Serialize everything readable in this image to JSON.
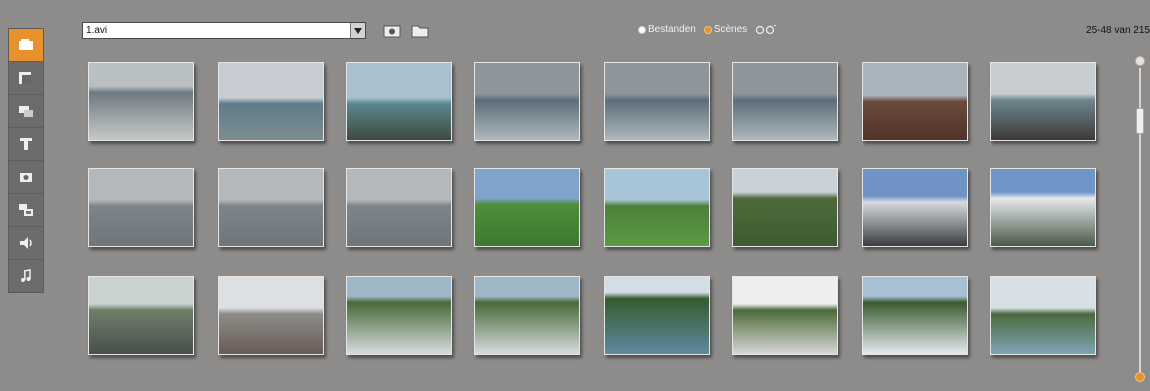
{
  "sidebar": {
    "items": [
      {
        "icon": "video-library-icon",
        "active": true
      },
      {
        "icon": "transitions-icon",
        "active": false
      },
      {
        "icon": "titles-icon",
        "active": false
      },
      {
        "icon": "text-icon",
        "active": false
      },
      {
        "icon": "photo-icon",
        "active": false
      },
      {
        "icon": "menu-icon",
        "active": false
      },
      {
        "icon": "sound-effects-icon",
        "active": false
      },
      {
        "icon": "music-icon",
        "active": false
      }
    ]
  },
  "toolbar": {
    "file_value": "1.avi",
    "radio_files": "Bestanden",
    "radio_scenes": "Scènes",
    "counter": "25-48 van 215"
  },
  "colors": {
    "accent": "#e8922e",
    "background": "#8e8c8a"
  },
  "scenes": [
    {
      "theme": "ferry-deck"
    },
    {
      "theme": "harbor-side"
    },
    {
      "theme": "harbor-cliff"
    },
    {
      "theme": "ferry-wake"
    },
    {
      "theme": "ferry-wake"
    },
    {
      "theme": "ferry-wake"
    },
    {
      "theme": "rocky-shore"
    },
    {
      "theme": "ferry-rail"
    },
    {
      "theme": "grey-sea"
    },
    {
      "theme": "grey-sea"
    },
    {
      "theme": "grey-sea"
    },
    {
      "theme": "campsite"
    },
    {
      "theme": "meadow-forest"
    },
    {
      "theme": "mountain-forest"
    },
    {
      "theme": "snow-road"
    },
    {
      "theme": "snow-mountain"
    },
    {
      "theme": "rainy-road"
    },
    {
      "theme": "snow-slope"
    },
    {
      "theme": "waterfall-rocks"
    },
    {
      "theme": "waterfall-rocks"
    },
    {
      "theme": "forest-lake"
    },
    {
      "theme": "snow-forest"
    },
    {
      "theme": "waterfall"
    },
    {
      "theme": "lakeside-trees"
    }
  ]
}
